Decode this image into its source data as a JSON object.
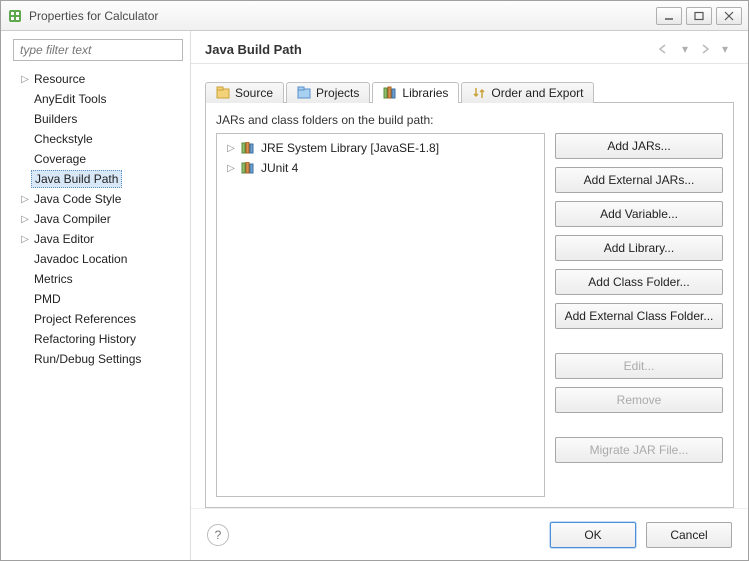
{
  "window": {
    "title": "Properties for Calculator"
  },
  "sidebar": {
    "filter_placeholder": "type filter text",
    "items": [
      {
        "label": "Resource",
        "expandable": true
      },
      {
        "label": "AnyEdit Tools"
      },
      {
        "label": "Builders"
      },
      {
        "label": "Checkstyle"
      },
      {
        "label": "Coverage"
      },
      {
        "label": "Java Build Path",
        "selected": true
      },
      {
        "label": "Java Code Style",
        "expandable": true
      },
      {
        "label": "Java Compiler",
        "expandable": true
      },
      {
        "label": "Java Editor",
        "expandable": true
      },
      {
        "label": "Javadoc Location"
      },
      {
        "label": "Metrics"
      },
      {
        "label": "PMD"
      },
      {
        "label": "Project References"
      },
      {
        "label": "Refactoring History"
      },
      {
        "label": "Run/Debug Settings"
      }
    ]
  },
  "main": {
    "title": "Java Build Path",
    "tabs": [
      {
        "label": "Source",
        "icon": "source-icon"
      },
      {
        "label": "Projects",
        "icon": "projects-icon"
      },
      {
        "label": "Libraries",
        "icon": "libraries-icon",
        "active": true
      },
      {
        "label": "Order and Export",
        "icon": "order-icon"
      }
    ],
    "pane_label": "JARs and class folders on the build path:",
    "jars": [
      {
        "label": "JRE System Library [JavaSE-1.8]"
      },
      {
        "label": "JUnit 4"
      }
    ],
    "buttons": {
      "add_jars": "Add JARs...",
      "add_external_jars": "Add External JARs...",
      "add_variable": "Add Variable...",
      "add_library": "Add Library...",
      "add_class_folder": "Add Class Folder...",
      "add_external_class_folder": "Add External Class Folder...",
      "edit": "Edit...",
      "remove": "Remove",
      "migrate": "Migrate JAR File..."
    }
  },
  "footer": {
    "ok": "OK",
    "cancel": "Cancel"
  }
}
